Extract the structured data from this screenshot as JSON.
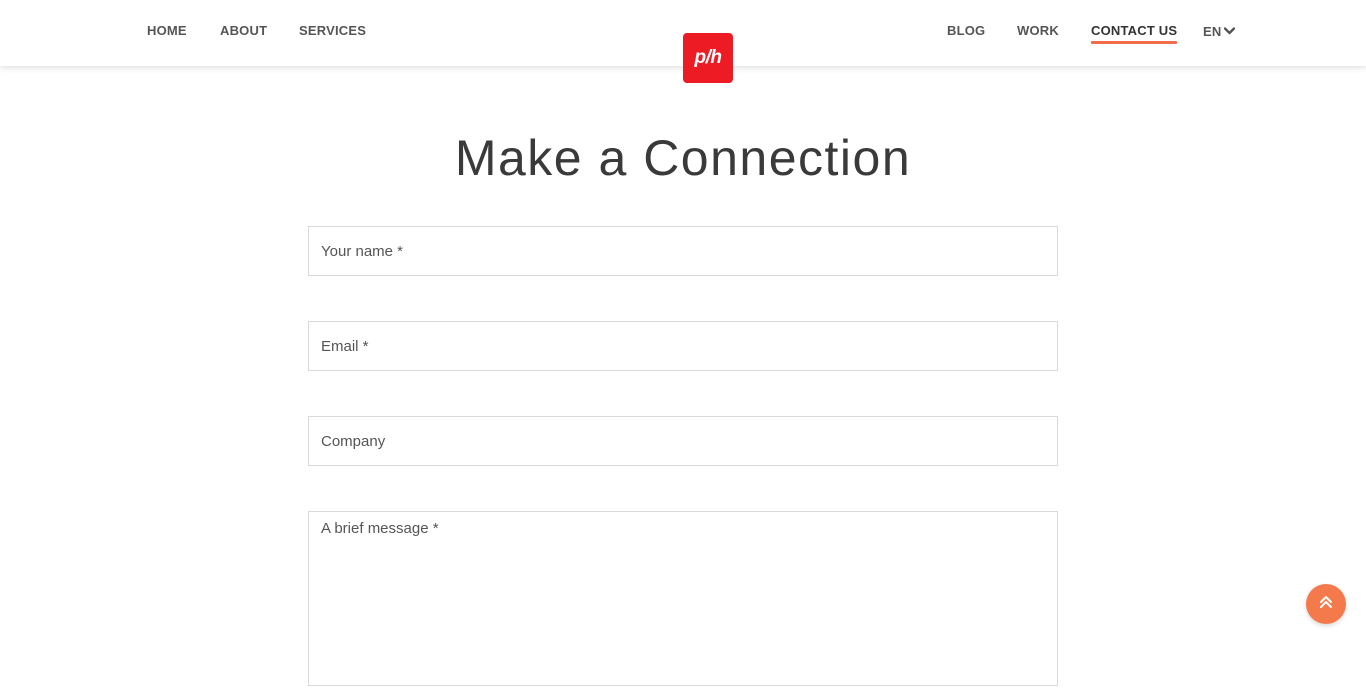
{
  "nav": {
    "left": [
      {
        "label": "HOME"
      },
      {
        "label": "ABOUT"
      },
      {
        "label": "SERVICES"
      }
    ],
    "right": [
      {
        "label": "BLOG"
      },
      {
        "label": "WORK"
      },
      {
        "label": "CONTACT US",
        "active": true
      }
    ],
    "language": "EN"
  },
  "logo": {
    "text": "p/h",
    "color": "#ed1c24"
  },
  "page": {
    "title": "Make a Connection"
  },
  "form": {
    "name_placeholder": "Your name *",
    "email_placeholder": "Email *",
    "company_placeholder": "Company",
    "message_placeholder": "A brief message *"
  },
  "colors": {
    "accent": "#f26b4a",
    "scroll_button": "#f47a4c"
  },
  "icons": {
    "scroll_top": "double-chevron-up-icon",
    "language": "chevron-down-icon"
  }
}
